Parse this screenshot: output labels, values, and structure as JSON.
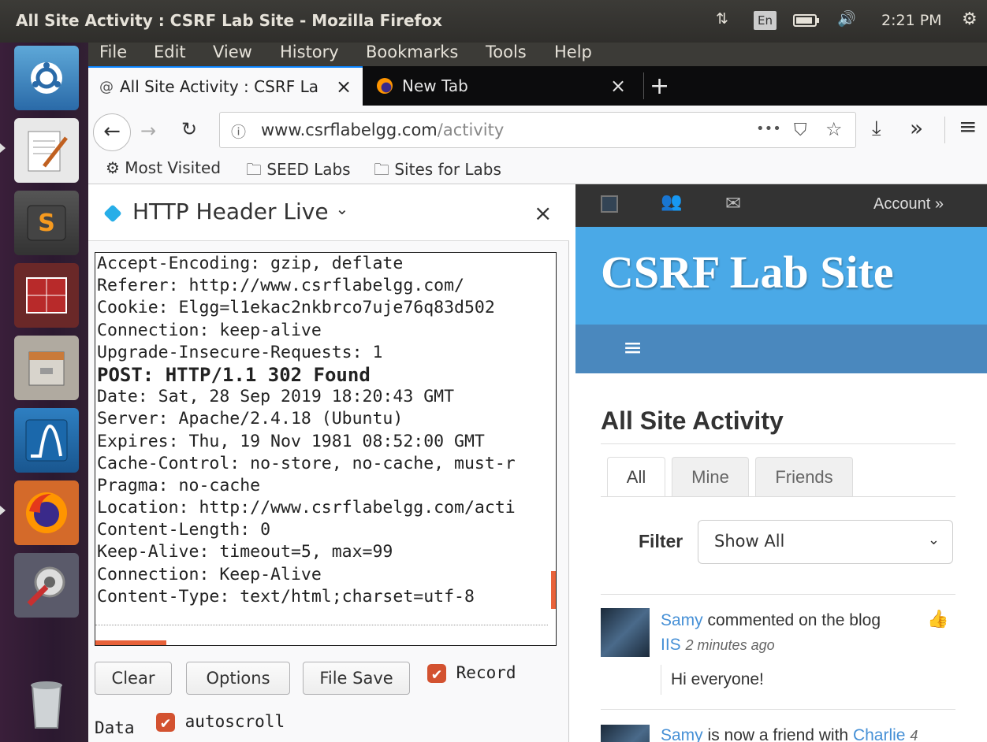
{
  "window": {
    "title": "All Site Activity : CSRF Lab Site - Mozilla Firefox"
  },
  "indicators": {
    "lang": "En",
    "time": "2:21 PM"
  },
  "menu": [
    "File",
    "Edit",
    "View",
    "History",
    "Bookmarks",
    "Tools",
    "Help"
  ],
  "tabs": [
    {
      "label": "All Site Activity : CSRF La",
      "close": "×"
    },
    {
      "label": "New Tab",
      "close": "×"
    }
  ],
  "newtab": "+",
  "url": {
    "host": "www.csrflabelgg.com",
    "path": "/activity",
    "more": "•••"
  },
  "bookmarks": [
    "Most Visited",
    "SEED Labs",
    "Sites for Labs"
  ],
  "sidebar": {
    "title": "HTTP Header Live",
    "chevron": "⌄",
    "close": "×",
    "lines": [
      "Accept-Encoding: gzip, deflate",
      "Referer: http://www.csrflabelgg.com/",
      "Cookie: Elgg=l1ekac2nkbrco7uje76q83d502",
      "Connection: keep-alive",
      "Upgrade-Insecure-Requests: 1",
      "POST: HTTP/1.1 302 Found",
      "Date: Sat, 28 Sep 2019 18:20:43 GMT",
      "Server: Apache/2.4.18 (Ubuntu)",
      "Expires: Thu, 19 Nov 1981 08:52:00 GMT",
      "Cache-Control: no-store, no-cache, must-r",
      "Pragma: no-cache",
      "Location: http://www.csrflabelgg.com/acti",
      "Content-Length: 0",
      "Keep-Alive: timeout=5, max=99",
      "Connection: Keep-Alive",
      "Content-Type: text/html;charset=utf-8"
    ],
    "bold_line": 5,
    "buttons": {
      "clear": "Clear",
      "options": "Options",
      "filesave": "File Save"
    },
    "record": "Record",
    "data_label": "Data",
    "autoscroll": "autoscroll"
  },
  "site": {
    "account": "Account »",
    "name": "CSRF Lab Site",
    "heading": "All Site Activity",
    "tabs": [
      "All",
      "Mine",
      "Friends"
    ],
    "filter_label": "Filter",
    "filter_value": "Show All",
    "activity": [
      {
        "user": "Samy",
        "text": " commented on the blog",
        "target": "IIS",
        "time": "2 minutes ago",
        "excerpt": "Hi everyone!"
      },
      {
        "user": "Samy",
        "text": " is now a friend with ",
        "target": "Charlie",
        "time": "4"
      }
    ]
  },
  "colors": {
    "ubuntu_bar": "#3c3b37",
    "launcher": "#2b1930",
    "elgg_blue": "#4aa9e7",
    "elgg_nav": "#4a88be",
    "record_orange": "#d35230"
  }
}
